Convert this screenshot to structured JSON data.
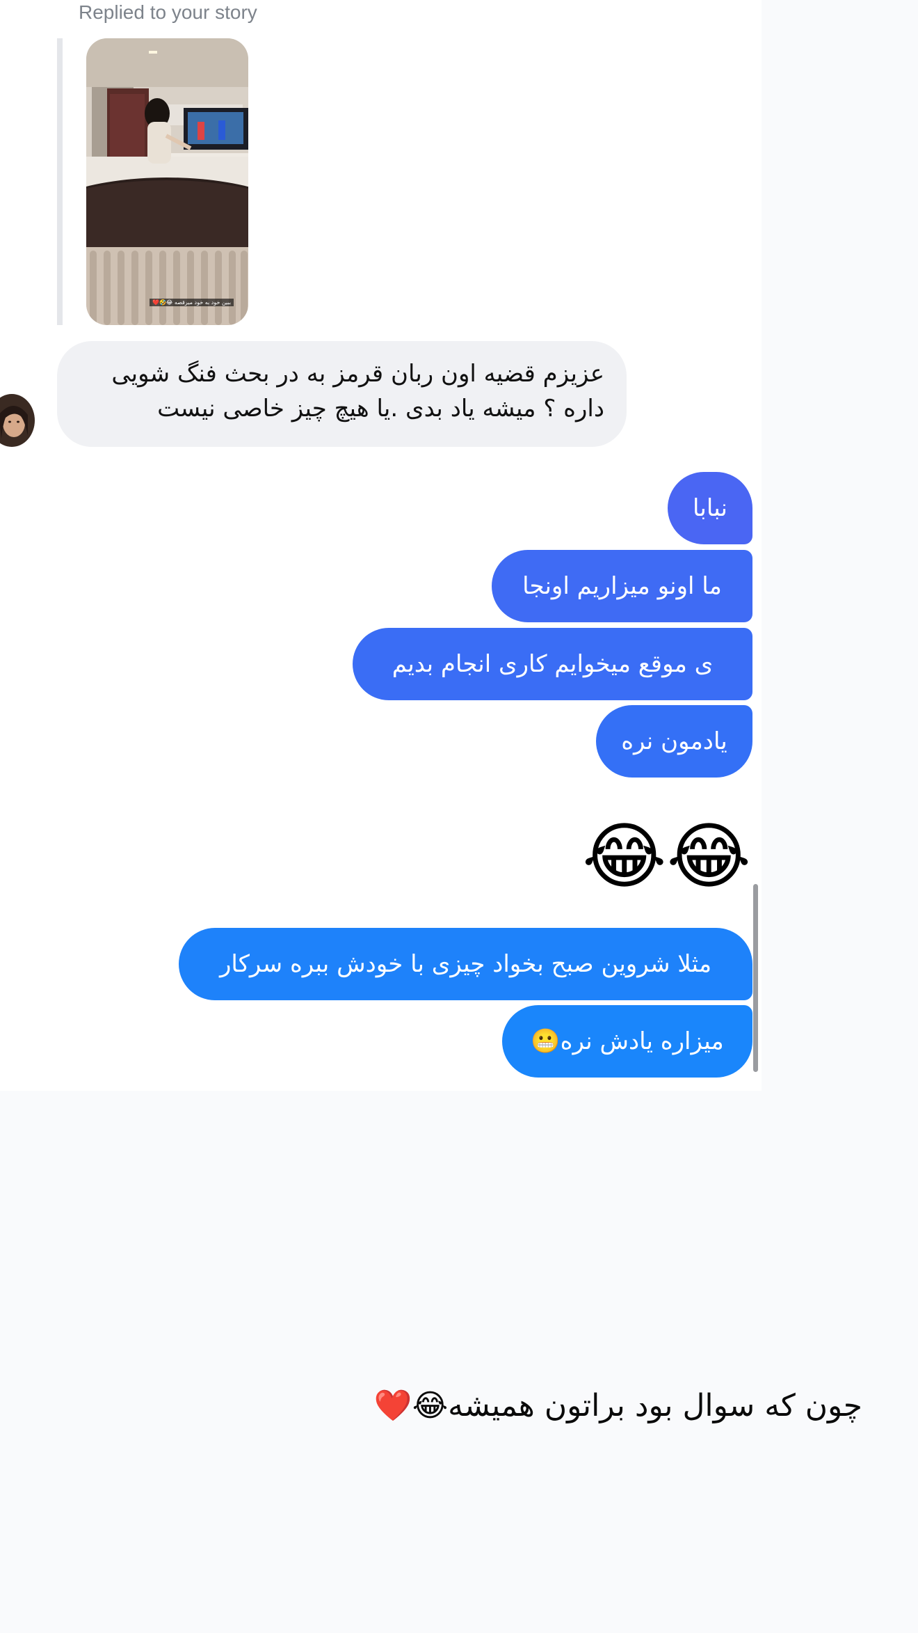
{
  "conversation": {
    "replied_label": "Replied to your story",
    "story": {
      "caption": "ببین خود به خود میرقصه 😂🤣❤️"
    },
    "incoming": {
      "line1": "عزیزم قضیه اون ربان قرمز به در بحث فنگ شویی",
      "line2": "داره ؟ میشه یاد بدی .یا هیچ چیز خاصی نیست"
    },
    "outgoing": [
      "نبابا",
      "ما اونو میزاریم اونجا",
      "ی موقع میخوایم کاری انجام بدیم",
      "یادمون نره",
      "مثلا شروین صبح بخواد چیزی با خودش ببره سرکار",
      "میزاره یادش نره😬"
    ],
    "emoji_message": "😂😂"
  },
  "post": {
    "caption": "چون که سوال بود براتون همیشه😂❤️"
  },
  "colors": {
    "outgoing_top": "#4a66f3",
    "outgoing_mid": "#3073f6",
    "outgoing_bottom": "#1a86fb",
    "incoming_bubble": "#f0f1f4",
    "page_background": "#f9fafc"
  }
}
